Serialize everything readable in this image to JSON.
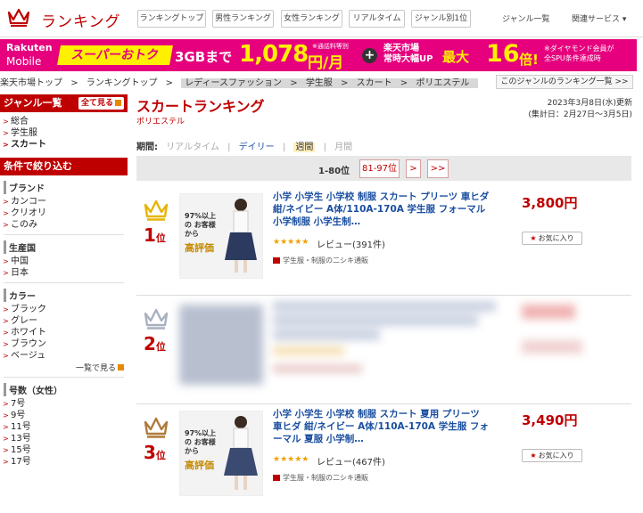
{
  "header": {
    "logo_text": "ランキング",
    "nav_buttons": [
      "ランキングトップ",
      "男性ランキング",
      "女性ランキング",
      "リアルタイム",
      "ジャンル別1位"
    ],
    "genre_list": "ジャンル一覧",
    "related": "関連サービス ▾"
  },
  "banner": {
    "brand_line1": "Rakuten",
    "brand_line2": "Mobile",
    "campaign": "スーパーおトク",
    "plan": "3GBまで",
    "price": "1,078",
    "price_unit": "円/月",
    "price_note": "※通話料等別",
    "plus": "+",
    "ichiba_line1": "楽天市場",
    "ichiba_line2": "常時大幅UP",
    "max": "最大",
    "multiplier": "16",
    "multiplier_unit": "倍!",
    "diamond_line1": "※ダイヤモンド会員が",
    "diamond_line2": "全SPU条件達成時"
  },
  "breadcrumb": [
    "楽天市場トップ",
    ">",
    "ランキングトップ",
    ">",
    "レディースファッション",
    ">",
    "学生服",
    ">",
    "スカート",
    ">",
    "ポリエステル"
  ],
  "genre_ranking_link": "このジャンルのランキング一覧 >>",
  "sidebar": {
    "genre_header": "ジャンル一覧",
    "see_all": "全て見る",
    "genres": [
      "総合",
      "学生服",
      "スカート"
    ],
    "filter_header": "条件で絞り込む",
    "brand_title": "ブランド",
    "brands": [
      "カンコー",
      "クリオリ",
      "このみ"
    ],
    "origin_title": "生産国",
    "origins": [
      "中国",
      "日本"
    ],
    "color_title": "カラー",
    "colors": [
      "ブラック",
      "グレー",
      "ホワイト",
      "ブラウン",
      "ベージュ"
    ],
    "see_more": "一覧で見る",
    "size_title": "号数（女性）",
    "sizes": [
      "7号",
      "9号",
      "11号",
      "13号",
      "15号",
      "17号"
    ]
  },
  "main": {
    "title": "スカートランキング",
    "subtitle": "ポリエステル",
    "updated": "2023年3月8日(水)更新",
    "period_range": "(集計日：2月27日～3月5日)",
    "period_label": "期間:",
    "periods": [
      "リアルタイム",
      "|",
      "デイリー",
      "|",
      "週間",
      "|",
      "月間"
    ],
    "pager": {
      "current": "1-80位",
      "next_range": "81-97位",
      "next": ">",
      "last": ">>"
    }
  },
  "items": [
    {
      "rank": "1",
      "rank_suffix": "位",
      "crown_color": "#e8b400",
      "title": "小学 小学生 小学校 制服 スカート プリーツ 車ヒダ 紺/ネイビー A体/110A-170A 学生服 フォーマル 小学制服 小学生制…",
      "price": "3,800円",
      "stars": "★★★★★",
      "reviews": "レビュー(391件)",
      "shop": "学生服・制服の二シキ通販",
      "fav": "お気に入り",
      "thumb_badge": "97%以上の お客様から",
      "thumb_high": "高評価"
    },
    {
      "rank": "2",
      "rank_suffix": "位",
      "crown_color": "#a8b0c0",
      "blurred": true
    },
    {
      "rank": "3",
      "rank_suffix": "位",
      "crown_color": "#b07a3a",
      "title": "小学 小学生 小学校 制服 スカート 夏用 プリーツ 車ヒダ 紺/ネイビー A体/110A-170A 学生服 フォーマル 夏服 小学制…",
      "price": "3,490円",
      "stars": "★★★★★",
      "reviews": "レビュー(467件)",
      "shop": "学生服・制服の二シキ通販",
      "fav": "お気に入り",
      "thumb_badge": "97%以上の お客様から",
      "thumb_high": "高評価"
    }
  ]
}
